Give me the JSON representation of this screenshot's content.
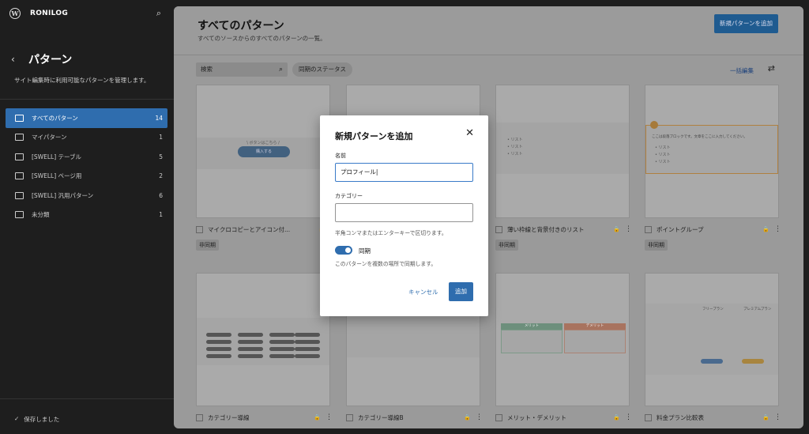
{
  "sidebar": {
    "site_name": "RONILOG",
    "title": "パターン",
    "description": "サイト編集時に利用可能なパターンを管理します。",
    "items": [
      {
        "label": "すべてのパターン",
        "count": "14"
      },
      {
        "label": "マイパターン",
        "count": "1"
      },
      {
        "label": "[SWELL] テーブル",
        "count": "5"
      },
      {
        "label": "[SWELL] ページ用",
        "count": "2"
      },
      {
        "label": "[SWELL] 汎用パターン",
        "count": "6"
      },
      {
        "label": "未分類",
        "count": "1"
      }
    ],
    "saved_status": "保存しました"
  },
  "main": {
    "title": "すべてのパターン",
    "subtitle": "すべてのソースからのすべてのパターンの一覧。",
    "add_button": "新規パターンを追加",
    "search_placeholder": "検索",
    "sync_status": "同期のステータス",
    "bulk_edit": "一括編集",
    "cards": [
      {
        "name": "マイクロコピーとアイコン付...",
        "badge": "非同期",
        "thumb_text": "\\ ボタンはこちら /",
        "thumb_btn": "購入する"
      },
      {
        "name": "",
        "badge": ""
      },
      {
        "name": "薄い枠線と背景付きのリスト",
        "badge": "非同期",
        "list": [
          "リスト",
          "リスト",
          "リスト"
        ]
      },
      {
        "name": "ポイントグループ",
        "badge": "非同期",
        "point_text": "ここは段落ブロックです。文章をここに入力してください。",
        "list": [
          "リスト",
          "リスト",
          "リスト"
        ]
      },
      {
        "name": "カテゴリー導線",
        "badge": ""
      },
      {
        "name": "カテゴリー導線B",
        "badge": ""
      },
      {
        "name": "メリット・デメリット",
        "badge": "",
        "cols": [
          "メリット",
          "デメリット"
        ]
      },
      {
        "name": "料金プラン比較表",
        "badge": "",
        "plans": [
          "フリープラン",
          "プレミアムプラン"
        ]
      }
    ]
  },
  "dialog": {
    "title": "新規パターンを追加",
    "name_label": "名前",
    "name_value": "プロフィール",
    "category_label": "カテゴリー",
    "category_value": "",
    "category_help": "半角コンマまたはエンターキーで区切ります。",
    "sync_label": "同期",
    "sync_help": "このパターンを複数の場所で同期します。",
    "cancel": "キャンセル",
    "submit": "追加",
    "sync_enabled": true
  }
}
